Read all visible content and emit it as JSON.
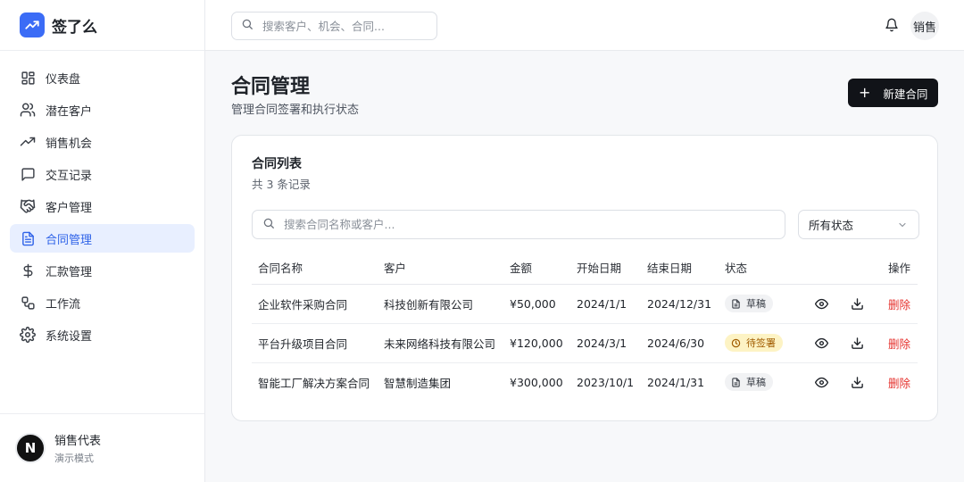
{
  "brand": {
    "name": "签了么",
    "accent": "#3b6cf6"
  },
  "sidebar": {
    "items": [
      {
        "label": "仪表盘",
        "icon": "dashboard-icon"
      },
      {
        "label": "潜在客户",
        "icon": "users-icon"
      },
      {
        "label": "销售机会",
        "icon": "trending-up-icon"
      },
      {
        "label": "交互记录",
        "icon": "message-square-icon"
      },
      {
        "label": "客户管理",
        "icon": "handshake-icon"
      },
      {
        "label": "合同管理",
        "icon": "file-text-icon",
        "active": true
      },
      {
        "label": "汇款管理",
        "icon": "dollar-sign-icon"
      },
      {
        "label": "工作流",
        "icon": "workflow-icon"
      },
      {
        "label": "系统设置",
        "icon": "settings-icon"
      }
    ],
    "user": {
      "avatar_letter": "N",
      "name": "销售代表",
      "mode": "演示模式"
    }
  },
  "topbar": {
    "search_placeholder": "搜索客户、机会、合同...",
    "user_label": "销售"
  },
  "page": {
    "title": "合同管理",
    "subtitle": "管理合同签署和执行状态",
    "new_button": "新建合同"
  },
  "card": {
    "title": "合同列表",
    "count": "共 3 条记录",
    "search_placeholder": "搜索合同名称或客户...",
    "status_filter": "所有状态"
  },
  "table": {
    "headers": [
      "合同名称",
      "客户",
      "金额",
      "开始日期",
      "结束日期",
      "状态",
      "操作"
    ],
    "rows": [
      {
        "name": "企业软件采购合同",
        "client": "科技创新有限公司",
        "amount": "¥50,000",
        "start": "2024/1/1",
        "end": "2024/12/31",
        "status": "草稿",
        "status_type": "draft",
        "delete": "删除"
      },
      {
        "name": "平台升级项目合同",
        "client": "未来网络科技有限公司",
        "amount": "¥120,000",
        "start": "2024/3/1",
        "end": "2024/6/30",
        "status": "待签署",
        "status_type": "pending",
        "delete": "删除"
      },
      {
        "name": "智能工厂解决方案合同",
        "client": "智慧制造集团",
        "amount": "¥300,000",
        "start": "2023/10/1",
        "end": "2024/1/31",
        "status": "草稿",
        "status_type": "draft",
        "delete": "删除"
      }
    ]
  }
}
